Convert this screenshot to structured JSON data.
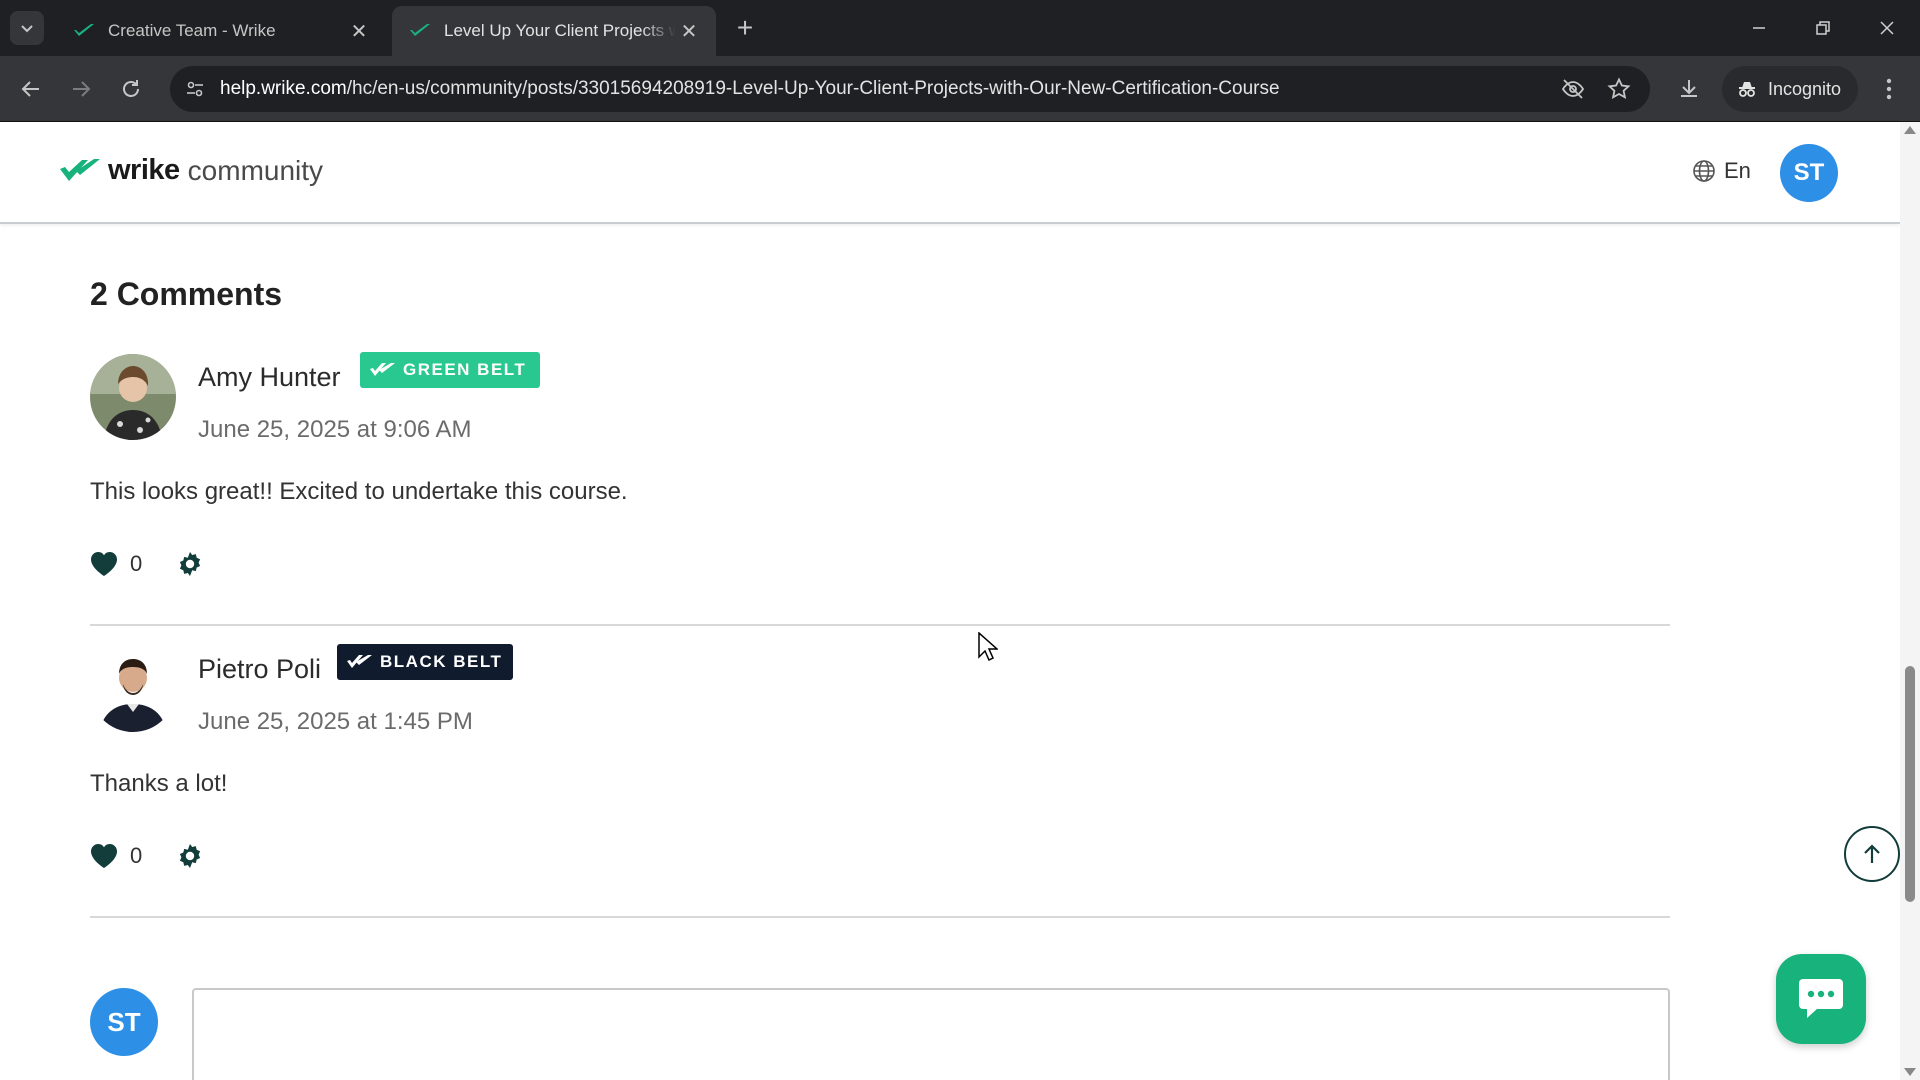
{
  "browser": {
    "tabs": [
      {
        "title": "Creative Team - Wrike",
        "active": false
      },
      {
        "title": "Level Up Your Client Projects with Our New Certification Course",
        "active": true
      }
    ],
    "url": {
      "host": "help.wrike.com",
      "path": "/hc/en-us/community/posts/33015694208919-Level-Up-Your-Client-Projects-with-Our-New-Certification-Course"
    },
    "incognito_label": "Incognito"
  },
  "header": {
    "logo_word": "wrike",
    "logo_suffix": "community",
    "language": "En",
    "user_initials": "ST"
  },
  "comments_section": {
    "title": "2 Comments",
    "comments": [
      {
        "author": "Amy Hunter",
        "badge": "GREEN BELT",
        "date": "June 25, 2025 at 9:06 AM",
        "body": "This looks great!! Excited to undertake this course.",
        "likes": "0"
      },
      {
        "author": "Pietro Poli",
        "badge": "BLACK BELT",
        "date": "June 25, 2025 at 1:45 PM",
        "body": "Thanks a lot!",
        "likes": "0"
      }
    ],
    "reply": {
      "user_initials": "ST",
      "placeholder": ""
    }
  },
  "colors": {
    "brand_green": "#18b27c",
    "green_belt": "#28c890",
    "black_belt": "#101b2d",
    "avatar_blue": "#2d8fe5"
  }
}
